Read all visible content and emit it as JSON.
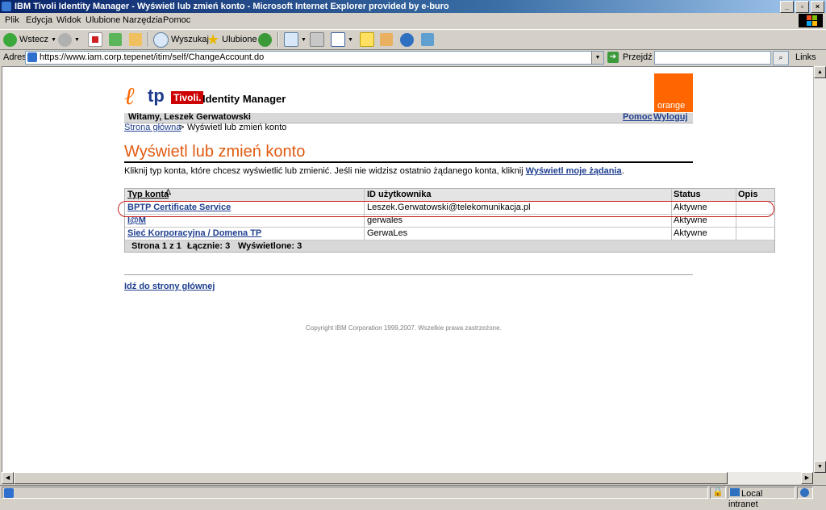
{
  "window": {
    "title": "IBM Tivoli Identity Manager - Wyświetl lub zmień konto - Microsoft Internet Explorer provided by e-buro",
    "buttons": [
      "_",
      "▫",
      "×"
    ]
  },
  "menu": [
    "Plik",
    "Edycja",
    "Widok",
    "Ulubione",
    "Narzędzia",
    "Pomoc"
  ],
  "toolbar": {
    "back_label": "Wstecz",
    "search_label": "Wyszukaj",
    "favorites_label": "Ulubione"
  },
  "address": {
    "label": "Adres",
    "url": "https://www.iam.corp.tepenet/itim/self/ChangeAccount.do",
    "go_label": "Przejdź",
    "links_label": "Links"
  },
  "page": {
    "logo_tp": "tp",
    "logo_tivoli": "Tivoli.",
    "logo_product": "Identity Manager",
    "orange_label": "orange",
    "welcome": "Witamy, Leszek Gerwatowski",
    "help_link": "Pomoc",
    "logout_link": "Wyloguj",
    "breadcrumb_home": "Strona główna",
    "breadcrumb_sep": ">",
    "breadcrumb_current": "Wyświetl lub zmień konto",
    "heading": "Wyświetl lub zmień konto",
    "intro_text": "Kliknij typ konta, które chcesz wyświetlić lub zmienić. Jeśli nie widzisz ostatnio żądanego konta, kliknij",
    "intro_link": "Wyświetl moje żądania",
    "intro_end": ".",
    "table": {
      "headers": [
        "Typ konta",
        "ID użytkownika",
        "Status",
        "Opis"
      ],
      "sort_indicator": "△",
      "rows": [
        {
          "type": "BPTP Certificate Service",
          "user": "Leszek.Gerwatowski@telekomunikacja.pl",
          "status": "Aktywne",
          "desc": ""
        },
        {
          "type": "I@M",
          "user": "gerwales",
          "status": "Aktywne",
          "desc": ""
        },
        {
          "type": "Sieć Korporacyjna / Domena TP",
          "user": "GerwaLes",
          "status": "Aktywne",
          "desc": ""
        }
      ],
      "footer": {
        "page": "Strona 1 z 1",
        "total": "Łącznie: 3",
        "shown": "Wyświetlone: 3"
      }
    },
    "back_link": "Idź do strony głównej",
    "copyright": "Copyright IBM Corporation 1999,2007. Wszelkie prawa zastrzeżone."
  },
  "status": {
    "zone": "Local intranet"
  }
}
